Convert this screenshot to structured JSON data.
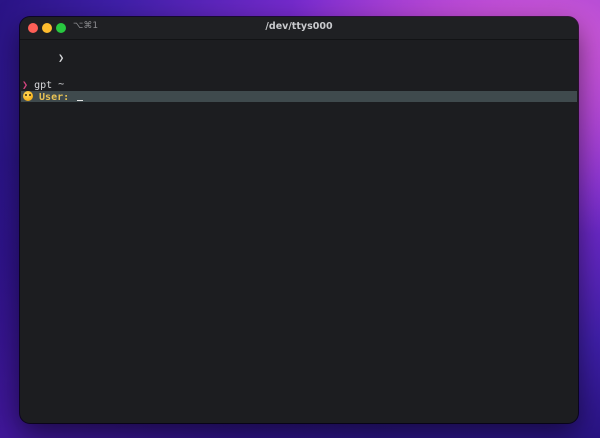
{
  "window": {
    "title": "/dev/ttys000",
    "shortcut": "⌥⌘1"
  },
  "terminal": {
    "line_prompt_marker": "❯",
    "line_cwd": "~",
    "command_arrow": "❯",
    "command": "gpt",
    "user_label": "User:",
    "emoji_icon": "face-emoji-icon"
  },
  "colors": {
    "prompt_arrow": "#d2447d",
    "user_label": "#e8c254",
    "terminal_bg": "#1c1d20",
    "highlight_row": "#3f4a4d"
  }
}
